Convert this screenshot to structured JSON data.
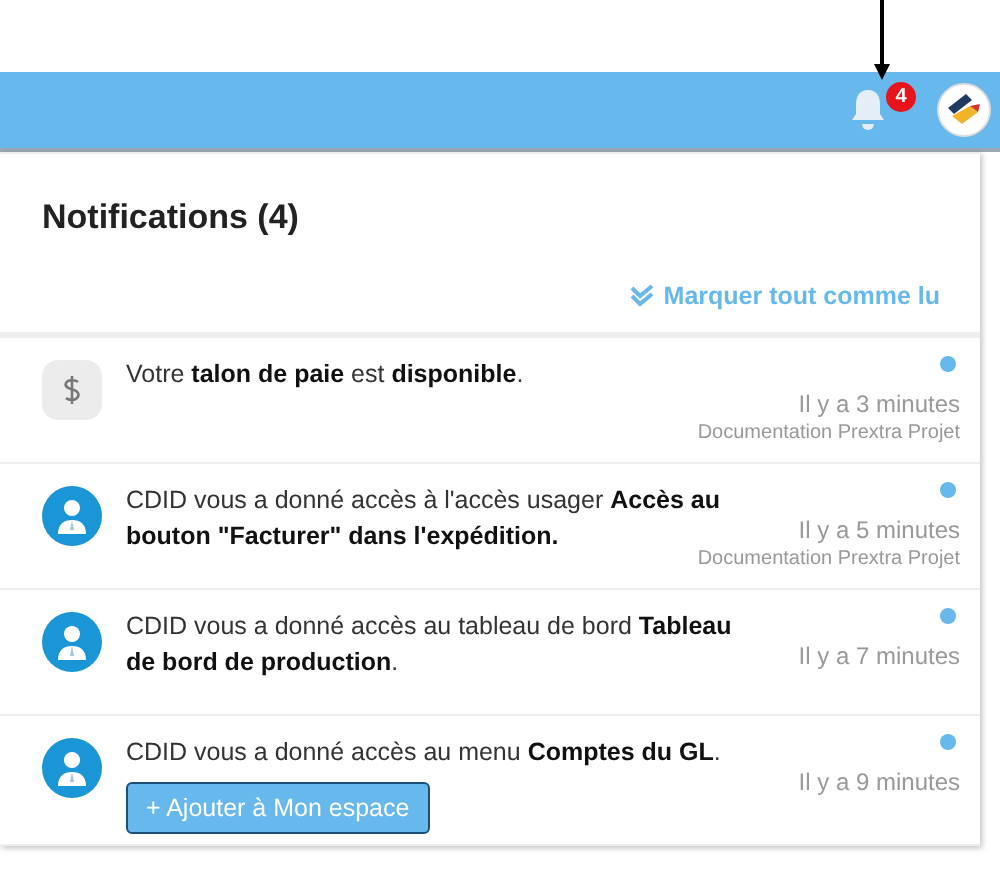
{
  "header": {
    "notification_count": "4"
  },
  "panel": {
    "title": "Notifications (4)",
    "mark_all_read": "Marquer tout comme lu"
  },
  "notifications": [
    {
      "kind": "pay",
      "message": "Votre **talon de paie** est **disponible**.",
      "time": "Il y a 3 minutes",
      "source": "Documentation Prextra Projet",
      "unread": true
    },
    {
      "kind": "user",
      "message": "CDID vous a donné accès à l'accès usager **Accès au bouton \"Facturer\" dans l'expédition.**",
      "time": "Il y a 5 minutes",
      "source": "Documentation Prextra Projet",
      "unread": true
    },
    {
      "kind": "user",
      "message": "CDID vous a donné accès au tableau de bord **Tableau de bord de production**.",
      "time": "Il y a 7 minutes",
      "unread": true
    },
    {
      "kind": "user",
      "message": "CDID vous a donné accès au menu **Comptes du GL**.",
      "time": "Il y a 9 minutes",
      "unread": true,
      "action": "+ Ajouter à Mon espace"
    }
  ]
}
